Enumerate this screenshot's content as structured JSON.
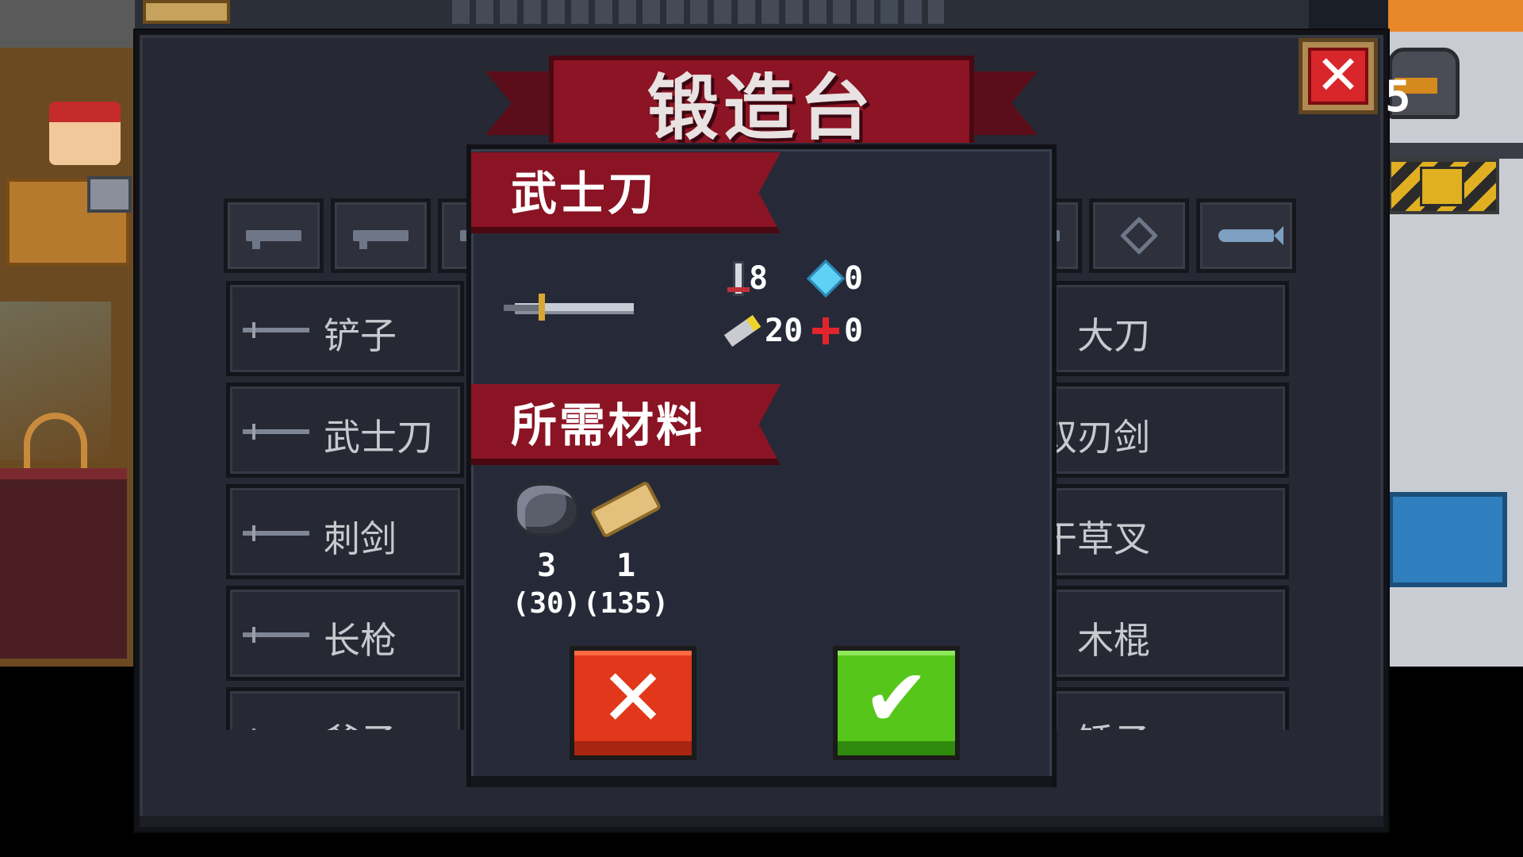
{
  "scene": {
    "hud_number": "5"
  },
  "forge": {
    "title": "锻造台",
    "close_label": "✕",
    "tabs": [
      {
        "icon": "pistol-icon"
      },
      {
        "icon": "rifle-icon"
      },
      {
        "icon": "weapon-icon"
      },
      {
        "icon": "weapon-icon"
      },
      {
        "icon": "shuriken-icon"
      },
      {
        "icon": "fish-icon"
      }
    ],
    "left_list": [
      {
        "label": "铲子",
        "icon": "shovel-icon"
      },
      {
        "label": "武士刀",
        "icon": "katana-icon"
      },
      {
        "label": "刺剑",
        "icon": "rapier-icon"
      },
      {
        "label": "长枪",
        "icon": "spear-icon"
      },
      {
        "label": "斧子",
        "icon": "axe-icon"
      }
    ],
    "right_list": [
      {
        "label": "大刀"
      },
      {
        "label": "双刃剑"
      },
      {
        "label": "干草叉"
      },
      {
        "label": "木棍"
      },
      {
        "label": "锤子"
      }
    ]
  },
  "dialog": {
    "weapon_name": "武士刀",
    "weapon_icon": "katana-icon",
    "stats": {
      "damage": "8",
      "energy_cost": "0",
      "crit": "20",
      "accuracy_offset": "0"
    },
    "materials_title": "所需材料",
    "materials": [
      {
        "icon": "iron-ore-icon",
        "required": "3",
        "owned": "(30)"
      },
      {
        "icon": "wood-icon",
        "required": "1",
        "owned": "(135)"
      }
    ],
    "cancel_label": "✕",
    "confirm_label": "✔"
  },
  "colors": {
    "ribbon_red": "#8a1424",
    "panel_bg": "#262833",
    "cancel_red": "#e1381b",
    "confirm_green": "#56c71a"
  }
}
